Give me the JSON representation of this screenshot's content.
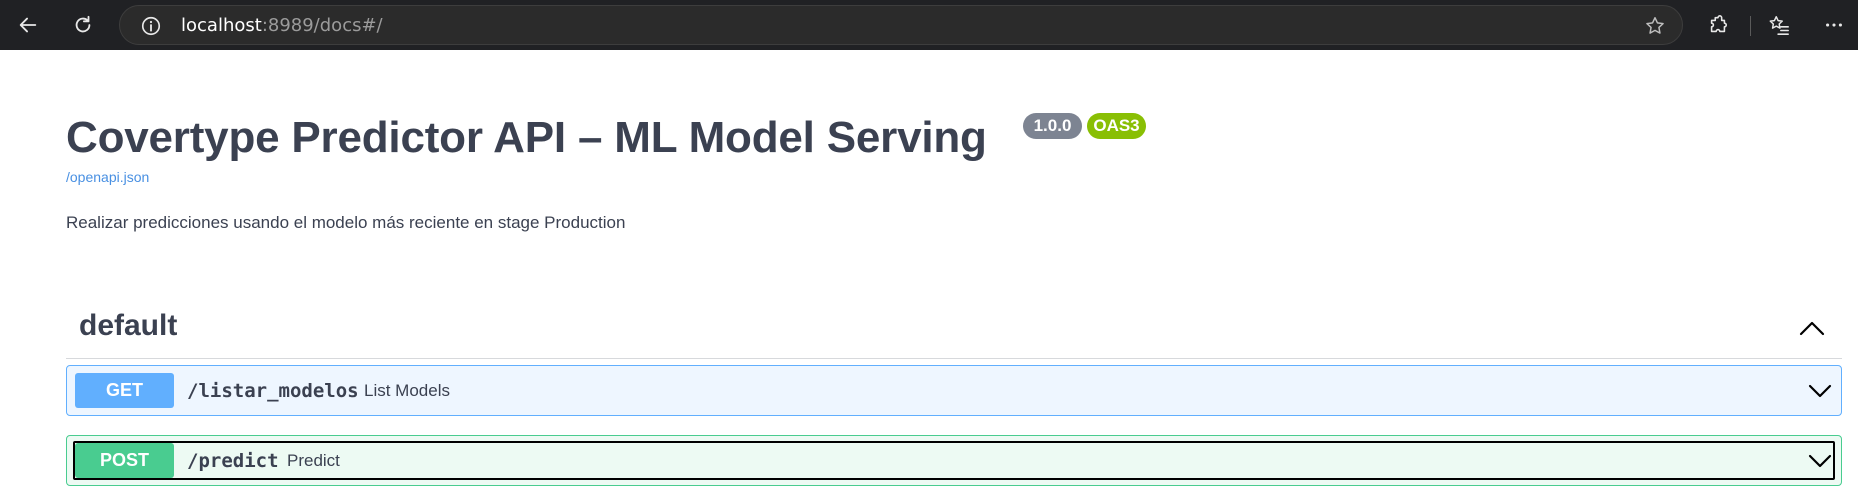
{
  "browser": {
    "url_host": "localhost",
    "url_rest": ":8989/docs#/"
  },
  "page": {
    "title": "Covertype Predictor API – ML Model Serving",
    "version_badge": "1.0.0",
    "oas_badge": "OAS3",
    "spec_link": "/openapi.json",
    "description": "Realizar predicciones usando el modelo más reciente en stage Production"
  },
  "tag": {
    "name": "default"
  },
  "operations": [
    {
      "method": "GET",
      "path": "/listar_modelos",
      "summary": "List Models"
    },
    {
      "method": "POST",
      "path": "/predict",
      "summary": "Predict"
    }
  ],
  "colors": {
    "get": "#61affe",
    "post": "#49cc90",
    "version_badge": "#7d8492",
    "oas_badge": "#89bf04",
    "link": "#4990e2"
  }
}
